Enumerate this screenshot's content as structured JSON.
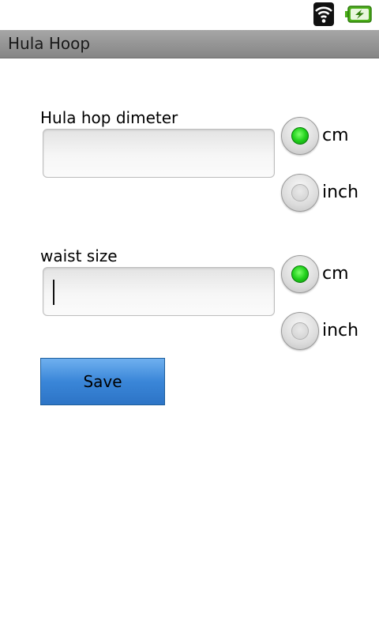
{
  "status_bar": {
    "icons": [
      "wifi-icon",
      "battery-charging-icon"
    ],
    "battery_color": "#4caf1a"
  },
  "app": {
    "title": "Hula Hoop"
  },
  "form": {
    "diameter": {
      "label": "Hula hop dimeter",
      "value": "",
      "units": [
        {
          "label": "cm",
          "selected": true
        },
        {
          "label": "inch",
          "selected": false
        }
      ]
    },
    "waist": {
      "label": "waist size",
      "value": "",
      "units": [
        {
          "label": "cm",
          "selected": true
        },
        {
          "label": "inch",
          "selected": false
        }
      ]
    },
    "save_label": "Save"
  },
  "colors": {
    "title_bar": "#9a9a9a",
    "radio_selected": "#22d11d",
    "button": "#3a86d8"
  }
}
